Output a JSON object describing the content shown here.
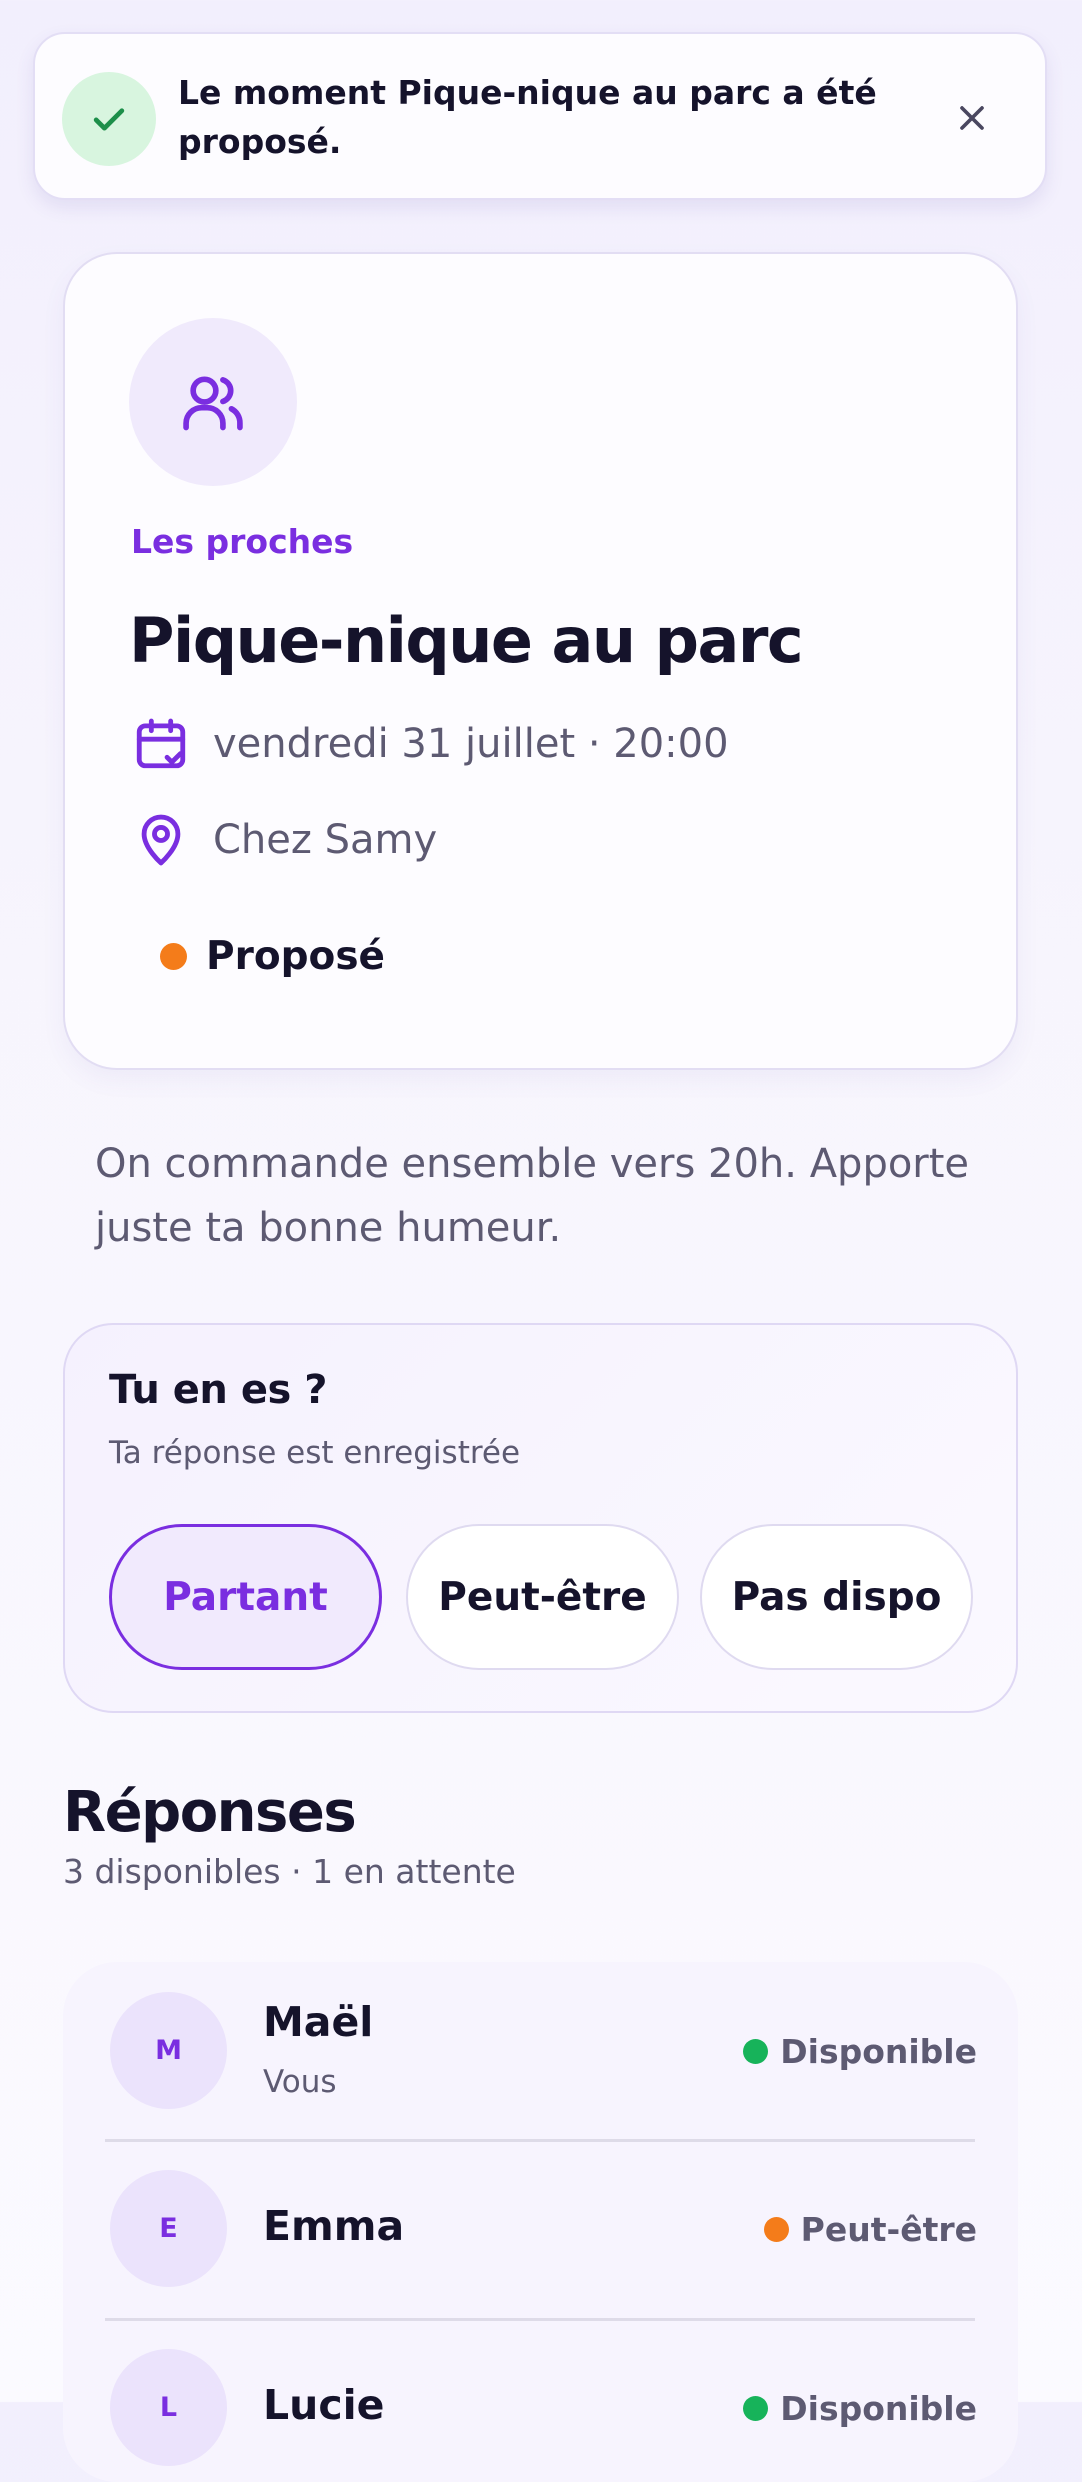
{
  "toast": {
    "message": "Le moment Pique-nique au parc a été proposé.",
    "check_icon": "check-icon",
    "close_icon": "close-icon"
  },
  "event": {
    "group_icon": "users-icon",
    "group_label": "Les proches",
    "title": "Pique-nique au parc",
    "date_icon": "calendar-check-icon",
    "datetime": "vendredi 31 juillet · 20:00",
    "location_icon": "map-pin-icon",
    "location": "Chez Samy",
    "status": "Proposé",
    "status_color": "#f47c1a"
  },
  "description": "On commande ensemble vers 20h. Apporte juste ta bonne humeur.",
  "rsvp": {
    "title": "Tu en es ?",
    "subtitle": "Ta réponse est enregistrée",
    "options": [
      "Partant",
      "Peut-être",
      "Pas dispo"
    ],
    "selected": "Partant"
  },
  "responses": {
    "title": "Réponses",
    "summary": "3 disponibles · 1 en attente",
    "items": [
      {
        "initial": "M",
        "name": "Maël",
        "note": "Vous",
        "status": "Disponible",
        "status_color": "#17b35a"
      },
      {
        "initial": "E",
        "name": "Emma",
        "note": "",
        "status": "Peut-être",
        "status_color": "#f47c1a"
      },
      {
        "initial": "L",
        "name": "Lucie",
        "note": "",
        "status": "Disponible",
        "status_color": "#17b35a"
      }
    ]
  },
  "colors": {
    "accent": "#7a2ee0",
    "success": "#17b35a",
    "warning": "#f47c1a",
    "text": "#15132b",
    "muted": "#5d5a72"
  }
}
